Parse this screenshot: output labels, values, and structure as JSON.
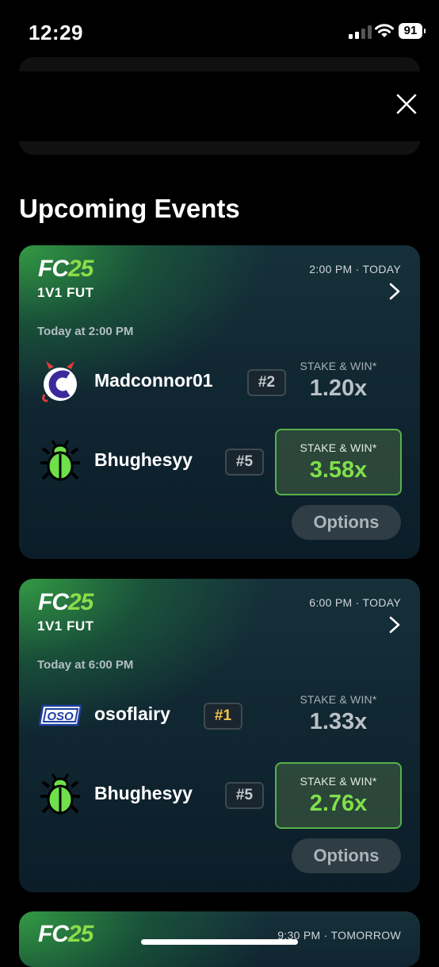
{
  "status_bar": {
    "time": "12:29",
    "battery": "91"
  },
  "section_title": "Upcoming Events",
  "events": [
    {
      "logo_prefix": "FC",
      "logo_number": "25",
      "time_label": "2:00 PM · TODAY",
      "type": "1V1 FUT",
      "date_label": "Today at 2:00 PM",
      "players": [
        {
          "name": "Madconnor01",
          "rank": "#2",
          "odds_label": "STAKE & WIN*",
          "odds": "1.20x",
          "selected": false
        },
        {
          "name": "Bhughesyy",
          "rank": "#5",
          "odds_label": "STAKE & WIN*",
          "odds": "3.58x",
          "selected": true
        }
      ],
      "options_label": "Options"
    },
    {
      "logo_prefix": "FC",
      "logo_number": "25",
      "time_label": "6:00 PM · TODAY",
      "type": "1V1 FUT",
      "date_label": "Today at 6:00 PM",
      "players": [
        {
          "name": "osoflairy",
          "rank": "#1",
          "odds_label": "STAKE & WIN*",
          "odds": "1.33x",
          "selected": false
        },
        {
          "name": "Bhughesyy",
          "rank": "#5",
          "odds_label": "STAKE & WIN*",
          "odds": "2.76x",
          "selected": true
        }
      ],
      "options_label": "Options"
    },
    {
      "logo_prefix": "FC",
      "logo_number": "25",
      "time_label": "9:30 PM · TOMORROW"
    }
  ],
  "colors": {
    "accent_green": "#7fe04b",
    "rank_gold": "#f2c34a"
  }
}
